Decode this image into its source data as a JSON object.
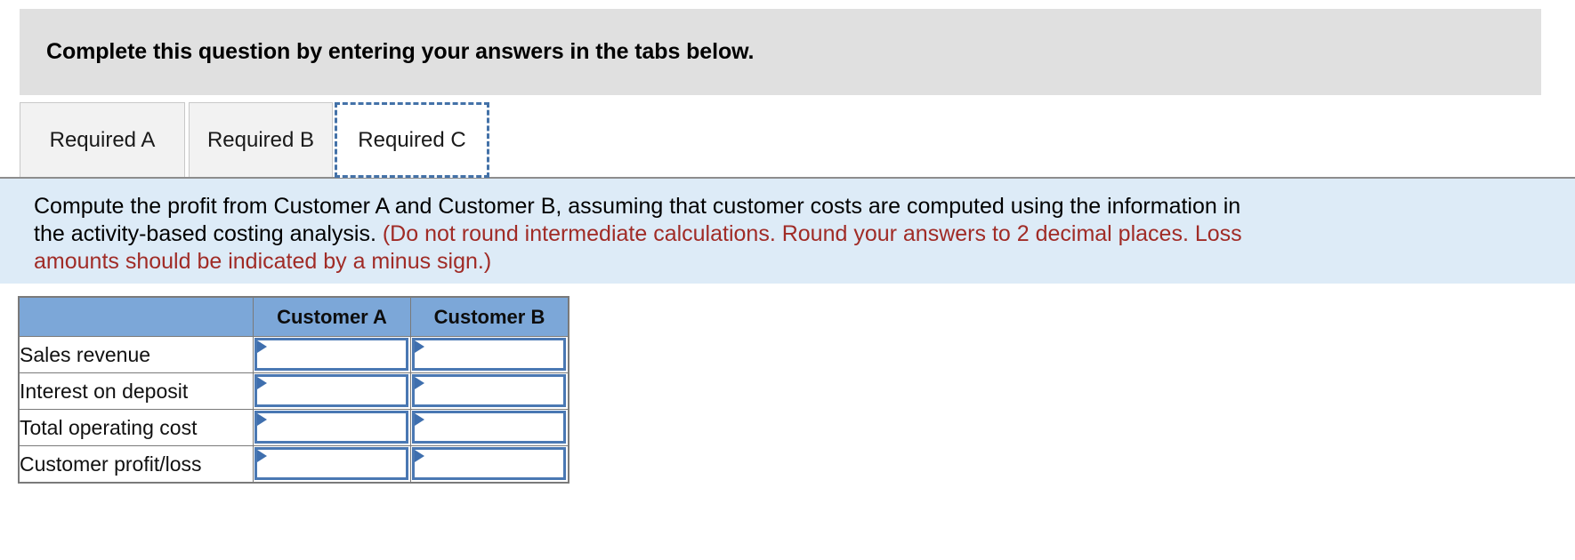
{
  "banner": {
    "text": "Complete this question by entering your answers in the tabs below."
  },
  "tabs": [
    {
      "id": "required-a",
      "label": "Required A",
      "active": false
    },
    {
      "id": "required-b",
      "label": "Required B",
      "active": false
    },
    {
      "id": "required-c",
      "label": "Required C",
      "active": true
    }
  ],
  "instructions": {
    "line1": "Compute the profit from Customer A and Customer B, assuming that customer costs are computed using the information in",
    "line2_main": "the activity-based costing analysis. ",
    "line2_note": "(Do not round intermediate calculations. Round your answers to 2 decimal places. Loss",
    "line3_note": "amounts should be indicated by a minus sign.)",
    "note_color": "#a02b26",
    "panel_color": "#ddebf7"
  },
  "table": {
    "header_color": "#7ca7d8",
    "input_border_color": "#4a78b3",
    "columns": [
      "",
      "Customer A",
      "Customer B"
    ],
    "rows": [
      {
        "label": "Sales revenue",
        "customer_a": "",
        "customer_b": ""
      },
      {
        "label": "Interest on deposit",
        "customer_a": "",
        "customer_b": ""
      },
      {
        "label": "Total operating cost",
        "customer_a": "",
        "customer_b": ""
      },
      {
        "label": "Customer profit/loss",
        "customer_a": "",
        "customer_b": ""
      }
    ]
  }
}
